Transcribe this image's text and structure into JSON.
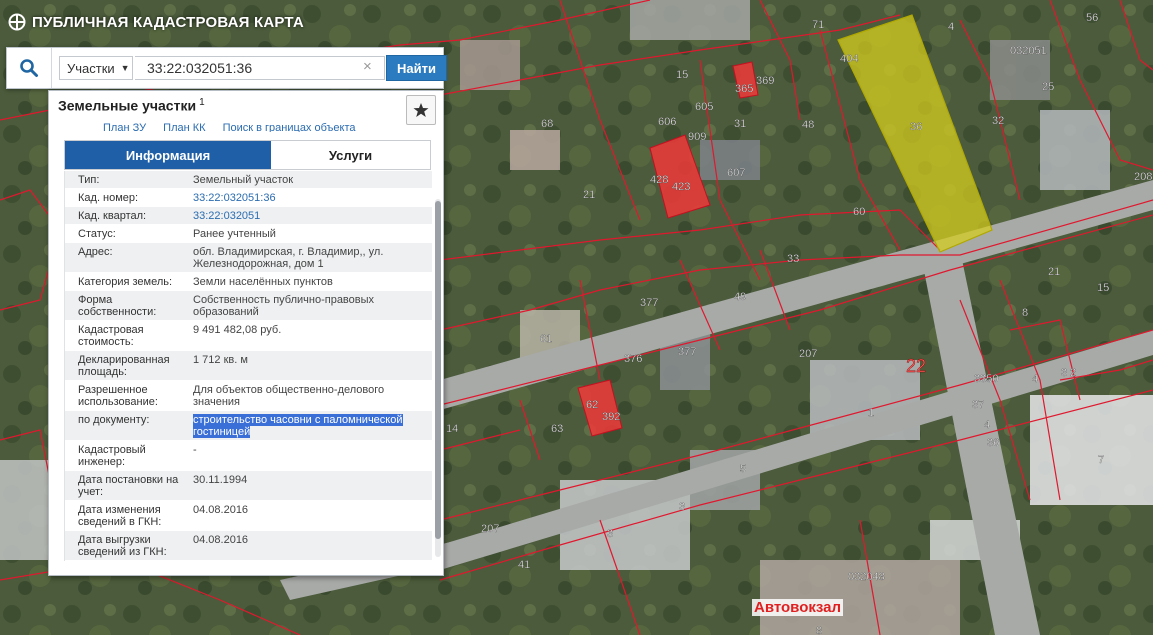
{
  "app": {
    "title": "ПУБЛИЧНАЯ КАДАСТРОВАЯ КАРТА"
  },
  "search": {
    "type_label": "Участки",
    "value": "33:22:032051:36",
    "clear": "×",
    "find_label": "Найти"
  },
  "panel": {
    "title": "Земельные участки",
    "count": "1",
    "links": [
      "План ЗУ",
      "План КК",
      "Поиск в границах объекта"
    ],
    "tabs": [
      {
        "label": "Информация"
      },
      {
        "label": "Услуги"
      }
    ],
    "rows": [
      {
        "label": "Тип:",
        "value": "Земельный участок"
      },
      {
        "label": "Кад. номер:",
        "value": "33:22:032051:36"
      },
      {
        "label": "Кад. квартал:",
        "value": "33:22:032051"
      },
      {
        "label": "Статус:",
        "value": "Ранее учтенный"
      },
      {
        "label": "Адрес:",
        "value": "обл. Владимирская, г. Владимир,, ул. Железнодорожная, дом 1"
      },
      {
        "label": "Категория земель:",
        "value": "Земли населённых пунктов"
      },
      {
        "label": "Форма собственности:",
        "value": "Собственность публично-правовых образований"
      },
      {
        "label": "Кадастровая стоимость:",
        "value": "9 491 482,08 руб."
      },
      {
        "label": "Декларированная площадь:",
        "value": "1 712 кв. м"
      },
      {
        "label": "Разрешенное использование:",
        "value": "Для объектов общественно-делового значения"
      },
      {
        "label": "по документу:",
        "value": "строительство часовни с паломнической гостиницей"
      },
      {
        "label": "Кадастровый инженер:",
        "value": "-"
      },
      {
        "label": "Дата постановки на учет:",
        "value": "30.11.1994"
      },
      {
        "label": "Дата изменения сведений в ГКН:",
        "value": "04.08.2016"
      },
      {
        "label": "Дата выгрузки сведений из ГКН:",
        "value": "04.08.2016"
      }
    ]
  },
  "map": {
    "labels": {
      "l4": "4",
      "l56": "56",
      "l032051": "032051",
      "l25": "25",
      "l32": "32",
      "l208": "208",
      "l71": "71",
      "l404": "404",
      "l36": "36",
      "l15a": "15",
      "l365": "365",
      "l369": "369",
      "l605": "605",
      "l31": "31",
      "l48": "48",
      "l68": "68",
      "l606": "606",
      "l909": "909",
      "l607": "607",
      "l428": "428",
      "l423": "423",
      "l21a": "21",
      "l60": "60",
      "l33": "33",
      "l21b": "21",
      "l15b": "15",
      "l377a": "377",
      "l49": "49",
      "l61": "61",
      "l376": "376",
      "l377b": "377",
      "l207a": "207",
      "l22": "22",
      "l3350": "3350",
      "l8": "8",
      "l4b": "4",
      "l32b": "3 2",
      "l1": "1",
      "l37": "37",
      "l4c": "4",
      "l36b": "36",
      "l62": "62",
      "l392": "392",
      "l63": "63",
      "l14": "14",
      "l7": "7",
      "l5": "5",
      "l3a": "3",
      "l3b": "3",
      "l207b": "207",
      "l41": "41",
      "l032048": "032048",
      "l8b": "8"
    },
    "bus_station": "Автовокзал"
  },
  "colors": {
    "primary": "#1e5fa8",
    "button": "#2a7bc0",
    "parcel_highlight": "#d4cc1f",
    "parcel_red": "#f03a3a",
    "border_red": "#e0182e"
  }
}
